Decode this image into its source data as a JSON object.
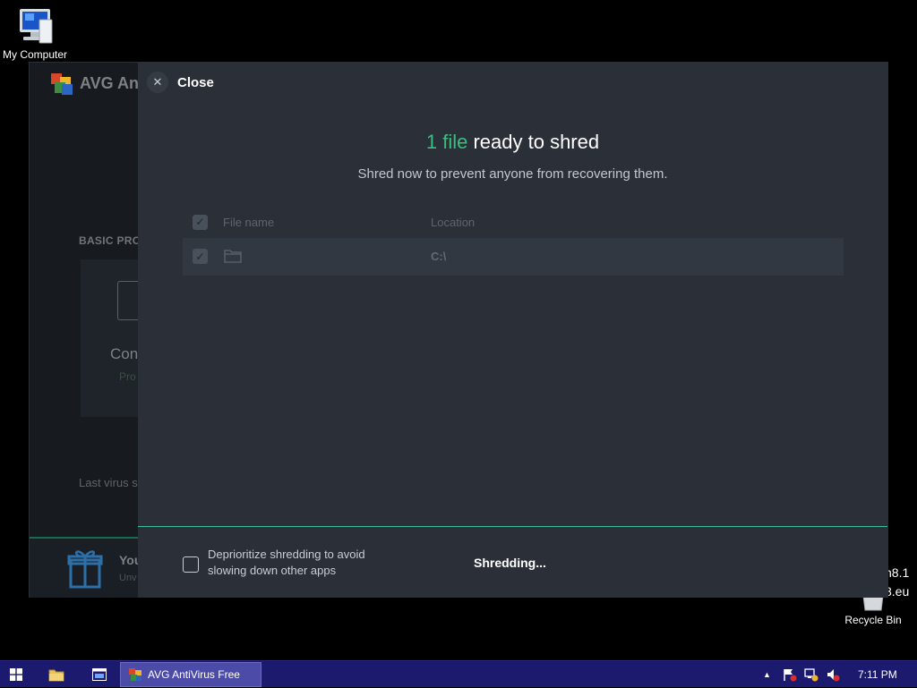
{
  "desktop": {
    "my_computer_label": "My Computer",
    "recycle_bin_label": "Recycle Bin",
    "watermark_line1": "n8.1",
    "watermark_line2": "8.eu"
  },
  "avg_background": {
    "logo_text": "AVG Ant",
    "section_title": "BASIC PRO",
    "card_title": "Con",
    "card_sub": "Pro",
    "last_scan": "Last virus s",
    "promo_title": "You",
    "promo_sub": "Unv"
  },
  "shredder": {
    "close_label": "Close",
    "headline_count": "1 file",
    "headline_rest": " ready to shred",
    "subline": "Shred now to prevent anyone from recovering them.",
    "table": {
      "columns": [
        "File name",
        "Location"
      ],
      "rows": [
        {
          "file_name": "",
          "location": "C:\\"
        }
      ]
    },
    "deprioritize_label": "Deprioritize shredding to avoid slowing down other apps",
    "status": "Shredding...",
    "accent_color": "#3bbf7f"
  },
  "taskbar": {
    "active_task_label": "AVG AntiVirus Free",
    "clock": "7:11 PM"
  }
}
